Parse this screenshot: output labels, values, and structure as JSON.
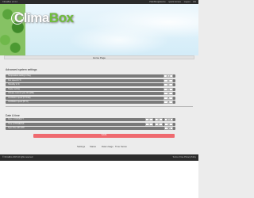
{
  "topbar": {
    "version": "ClimaBox v2.4.2",
    "links": [
      "PlainBox@device",
      "Quick Access",
      "Logout"
    ],
    "lang": "EN"
  },
  "banner": {
    "logo_part1": "Clima",
    "logo_part2": "Box"
  },
  "page": {
    "title": "Home Page",
    "advanced_title": "Advanced system settings",
    "advanced_rows": [
      {
        "label": "Temperature setting in Deg",
        "value": "23.0"
      },
      {
        "label": "Fan speed in %",
        "value": "30"
      },
      {
        "label": "Humidity in %",
        "value": "60"
      },
      {
        "label": "Heater setting",
        "value": "ON"
      },
      {
        "label": "Climate control cycle ON (MIN)",
        "value": "10"
      },
      {
        "label": "Ventilation speed (CYCLE)",
        "value": "15"
      },
      {
        "label": "Ventilation speed (IN %)",
        "value": "18"
      }
    ],
    "datetime_title": "Date & time",
    "datetime_rows": [
      {
        "label": "Date in DD/MM/YY",
        "values": [
          "27",
          "05",
          "2015"
        ]
      },
      {
        "label": "Time in HH:MM:SS",
        "values": [
          "9",
          "47",
          "42"
        ]
      },
      {
        "label": "Sync time with NTP",
        "values": [
          "YES"
        ]
      }
    ],
    "save_label": "SAVE"
  },
  "toolbar": {
    "items": [
      "Settings",
      "Status",
      "Data Usage",
      "Time Series"
    ]
  },
  "footer": {
    "left": "© ClimaBox 2015 All rights reserved",
    "right": "Terms of Use   Privacy Policy"
  }
}
